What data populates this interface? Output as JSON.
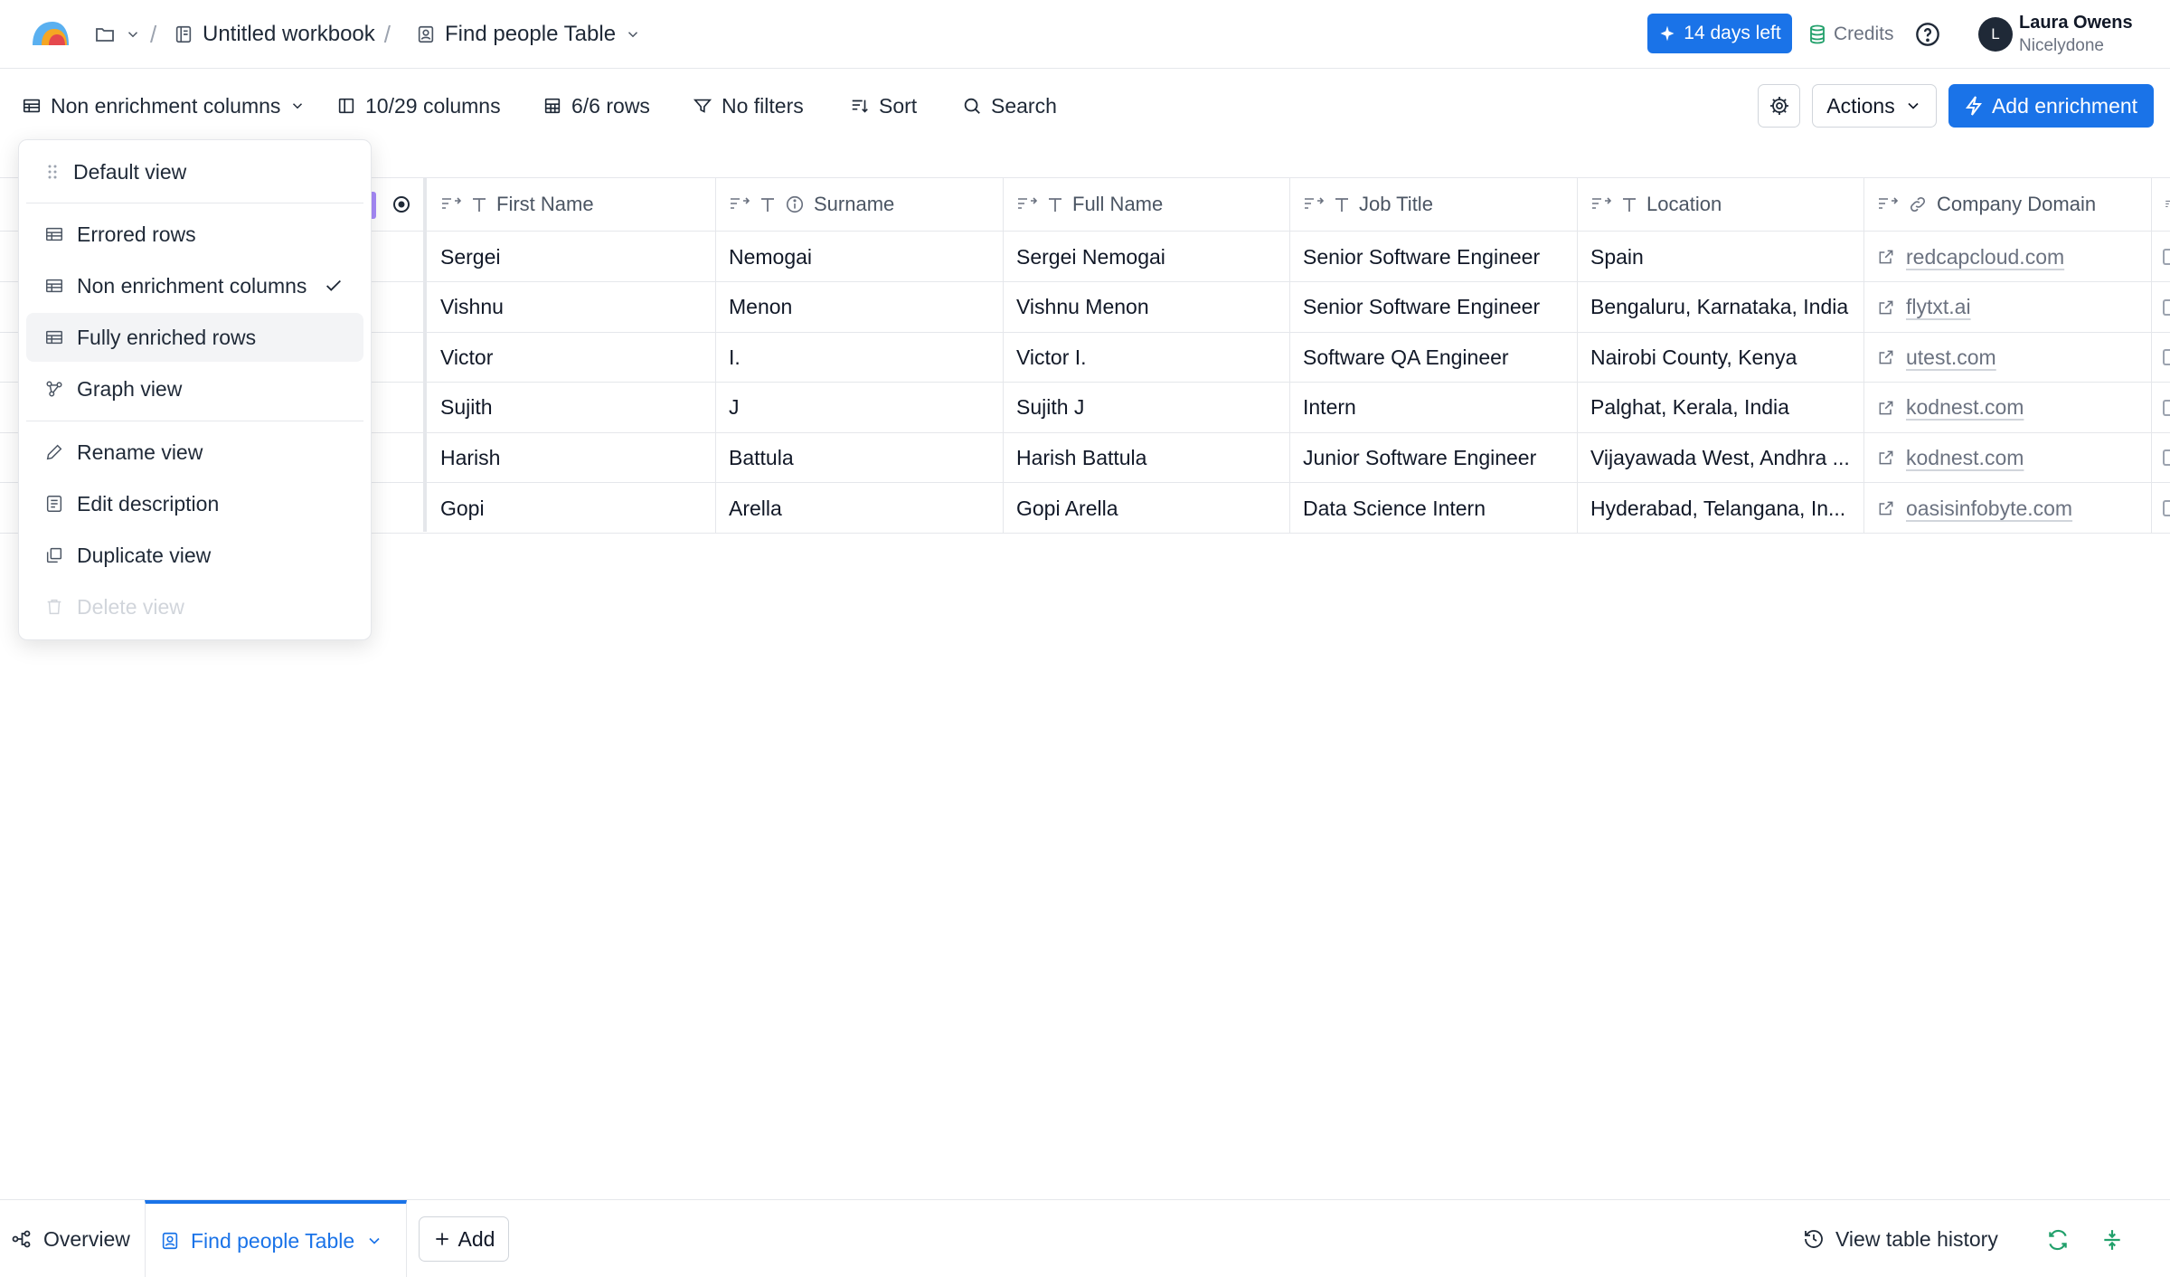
{
  "header": {
    "workbook": "Untitled workbook",
    "table": "Find people Table",
    "trial_label": "14 days left",
    "credits_label": "Credits",
    "user_initial": "L",
    "user_name": "Laura Owens",
    "user_org": "Nicelydone"
  },
  "toolbar": {
    "view_label": "Non enrichment columns",
    "columns_label": "10/29 columns",
    "rows_label": "6/6 rows",
    "filters_label": "No filters",
    "sort_label": "Sort",
    "search_label": "Search",
    "actions_label": "Actions",
    "add_enrichment_label": "Add enrichment"
  },
  "menu": {
    "items": [
      {
        "label": "Default view",
        "icon": "drag-handle-icon"
      },
      {
        "label": "Errored rows",
        "icon": "table-icon"
      },
      {
        "label": "Non enrichment columns",
        "icon": "table-icon",
        "selected": true
      },
      {
        "label": "Fully enriched rows",
        "icon": "table-icon"
      },
      {
        "label": "Graph view",
        "icon": "graph-icon"
      },
      {
        "label": "Rename view",
        "icon": "pencil-icon"
      },
      {
        "label": "Edit description",
        "icon": "description-icon"
      },
      {
        "label": "Duplicate view",
        "icon": "duplicate-icon"
      },
      {
        "label": "Delete view",
        "icon": "trash-icon",
        "disabled": true
      }
    ]
  },
  "table": {
    "columns": [
      "First Name",
      "Surname",
      "Full Name",
      "Job Title",
      "Location",
      "Company Domain"
    ],
    "rows": [
      [
        "Sergei",
        "Nemogai",
        "Sergei Nemogai",
        "Senior Software Engineer",
        "Spain",
        "redcapcloud.com"
      ],
      [
        "Vishnu",
        "Menon",
        "Vishnu Menon",
        "Senior Software Engineer",
        "Bengaluru, Karnataka, India",
        "flytxt.ai"
      ],
      [
        "Victor",
        "I.",
        "Victor I.",
        "Software QA Engineer",
        "Nairobi County, Kenya",
        "utest.com"
      ],
      [
        "Sujith",
        "J",
        "Sujith J",
        "Intern",
        "Palghat, Kerala, India",
        "kodnest.com"
      ],
      [
        "Harish",
        "Battula",
        "Harish Battula",
        "Junior Software Engineer",
        "Vijayawada West, Andhra ...",
        "kodnest.com"
      ],
      [
        "Gopi",
        "Arella",
        "Gopi Arella",
        "Data Science Intern",
        "Hyderabad, Telangana, In...",
        "oasisinfobyte.com"
      ]
    ]
  },
  "bottom": {
    "overview_label": "Overview",
    "active_tab_label": "Find people Table",
    "add_label": "Add",
    "history_label": "View table history"
  },
  "colors": {
    "accent": "#1a73e8",
    "credits_green": "#22a06b",
    "column_marker": "#a78bfa"
  }
}
